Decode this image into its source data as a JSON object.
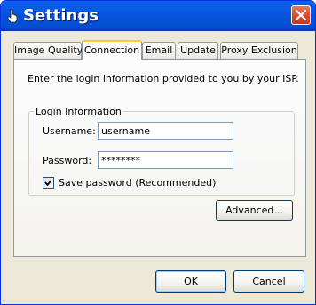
{
  "window": {
    "title": "Settings",
    "icon": "hand-pointer-icon"
  },
  "tabs": [
    {
      "label": "Image Quality",
      "active": false
    },
    {
      "label": "Connection",
      "active": true
    },
    {
      "label": "Email",
      "active": false
    },
    {
      "label": "Update",
      "active": false
    },
    {
      "label": "Proxy Exclusion",
      "active": false
    }
  ],
  "connection": {
    "intro": "Enter the login information provided to you by your ISP.",
    "group_label": "Login Information",
    "username_label": "Username:",
    "username_value": "username",
    "password_label": "Password:",
    "password_value": "********",
    "save_password_label": "Save password (Recommended)",
    "save_password_checked": true,
    "advanced_button": "Advanced..."
  },
  "footer": {
    "ok_button": "OK",
    "cancel_button": "Cancel"
  },
  "colors": {
    "titlebar": "#0553d6",
    "active_tab_accent": "#ffc83c",
    "close_button": "#d8472b"
  }
}
